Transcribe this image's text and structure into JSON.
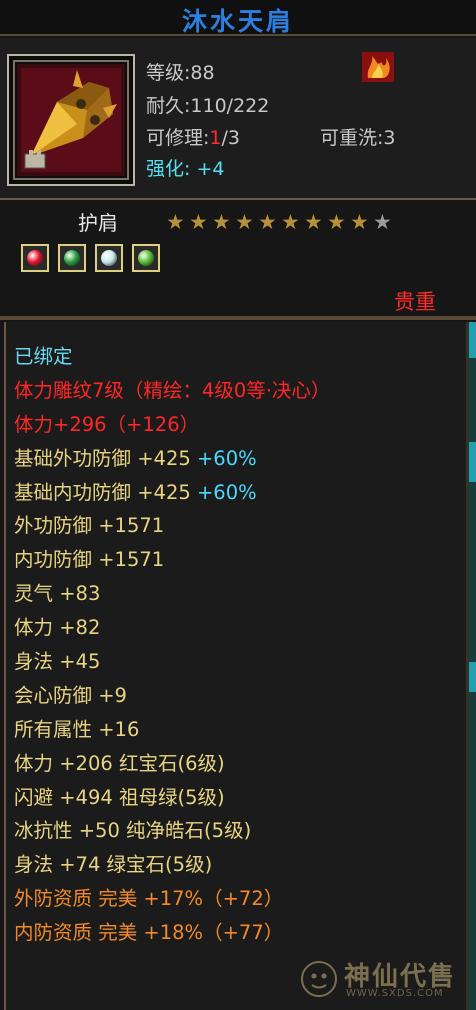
{
  "item": {
    "name": "沐水天肩",
    "slot_type": "护肩",
    "quality": "贵重"
  },
  "header": {
    "level": "等级:88",
    "durability": "耐久:110/222",
    "repair_prefix": "可修理:",
    "repair_current": "1",
    "repair_suffix": "/3",
    "reforge": "可重洗:3",
    "enhance": "强化: +4"
  },
  "stars": {
    "filled": 9,
    "total": 10
  },
  "gems": [
    {
      "name": "ruby-gem",
      "color": "#e01830"
    },
    {
      "name": "emerald-gem",
      "color": "#2aa040"
    },
    {
      "name": "diamond-gem",
      "color": "#c8e8e8"
    },
    {
      "name": "green-gem",
      "color": "#58c030"
    }
  ],
  "attributes": [
    {
      "text": "已绑定",
      "color": "cyan"
    },
    {
      "text": "体力雕纹7级（精绘：4级0等·决心）",
      "color": "red"
    },
    {
      "text": "体力+296（+126）",
      "color": "red"
    },
    {
      "text": "基础外功防御 +425",
      "extra": " +60%",
      "color": "gold"
    },
    {
      "text": "基础内功防御 +425",
      "extra": " +60%",
      "color": "gold"
    },
    {
      "text": "外功防御 +1571",
      "color": "gold"
    },
    {
      "text": "内功防御 +1571",
      "color": "gold"
    },
    {
      "text": "灵气 +83",
      "color": "gold"
    },
    {
      "text": "体力 +82",
      "color": "gold"
    },
    {
      "text": "身法 +45",
      "color": "gold"
    },
    {
      "text": "会心防御 +9",
      "color": "gold"
    },
    {
      "text": "所有属性 +16",
      "color": "gold"
    },
    {
      "text": "体力 +206 红宝石(6级)",
      "color": "gold"
    },
    {
      "text": "闪避 +494 祖母绿(5级)",
      "color": "gold"
    },
    {
      "text": "冰抗性 +50 纯净皓石(5级)",
      "color": "gold"
    },
    {
      "text": "身法 +74 绿宝石(5级)",
      "color": "gold"
    },
    {
      "text": "外防资质  完美 +17%（+72）",
      "color": "orange"
    },
    {
      "text": "内防资质  完美 +18%（+77）",
      "color": "orange"
    }
  ],
  "watermark": {
    "text": "神仙代售",
    "url": "WWW.SXDS.COM"
  },
  "colors": {
    "title": "#2c7fe0",
    "red": "#ff2626",
    "gold": "#e8d482",
    "orange": "#f08a2a",
    "cyan": "#6ad8f0"
  }
}
